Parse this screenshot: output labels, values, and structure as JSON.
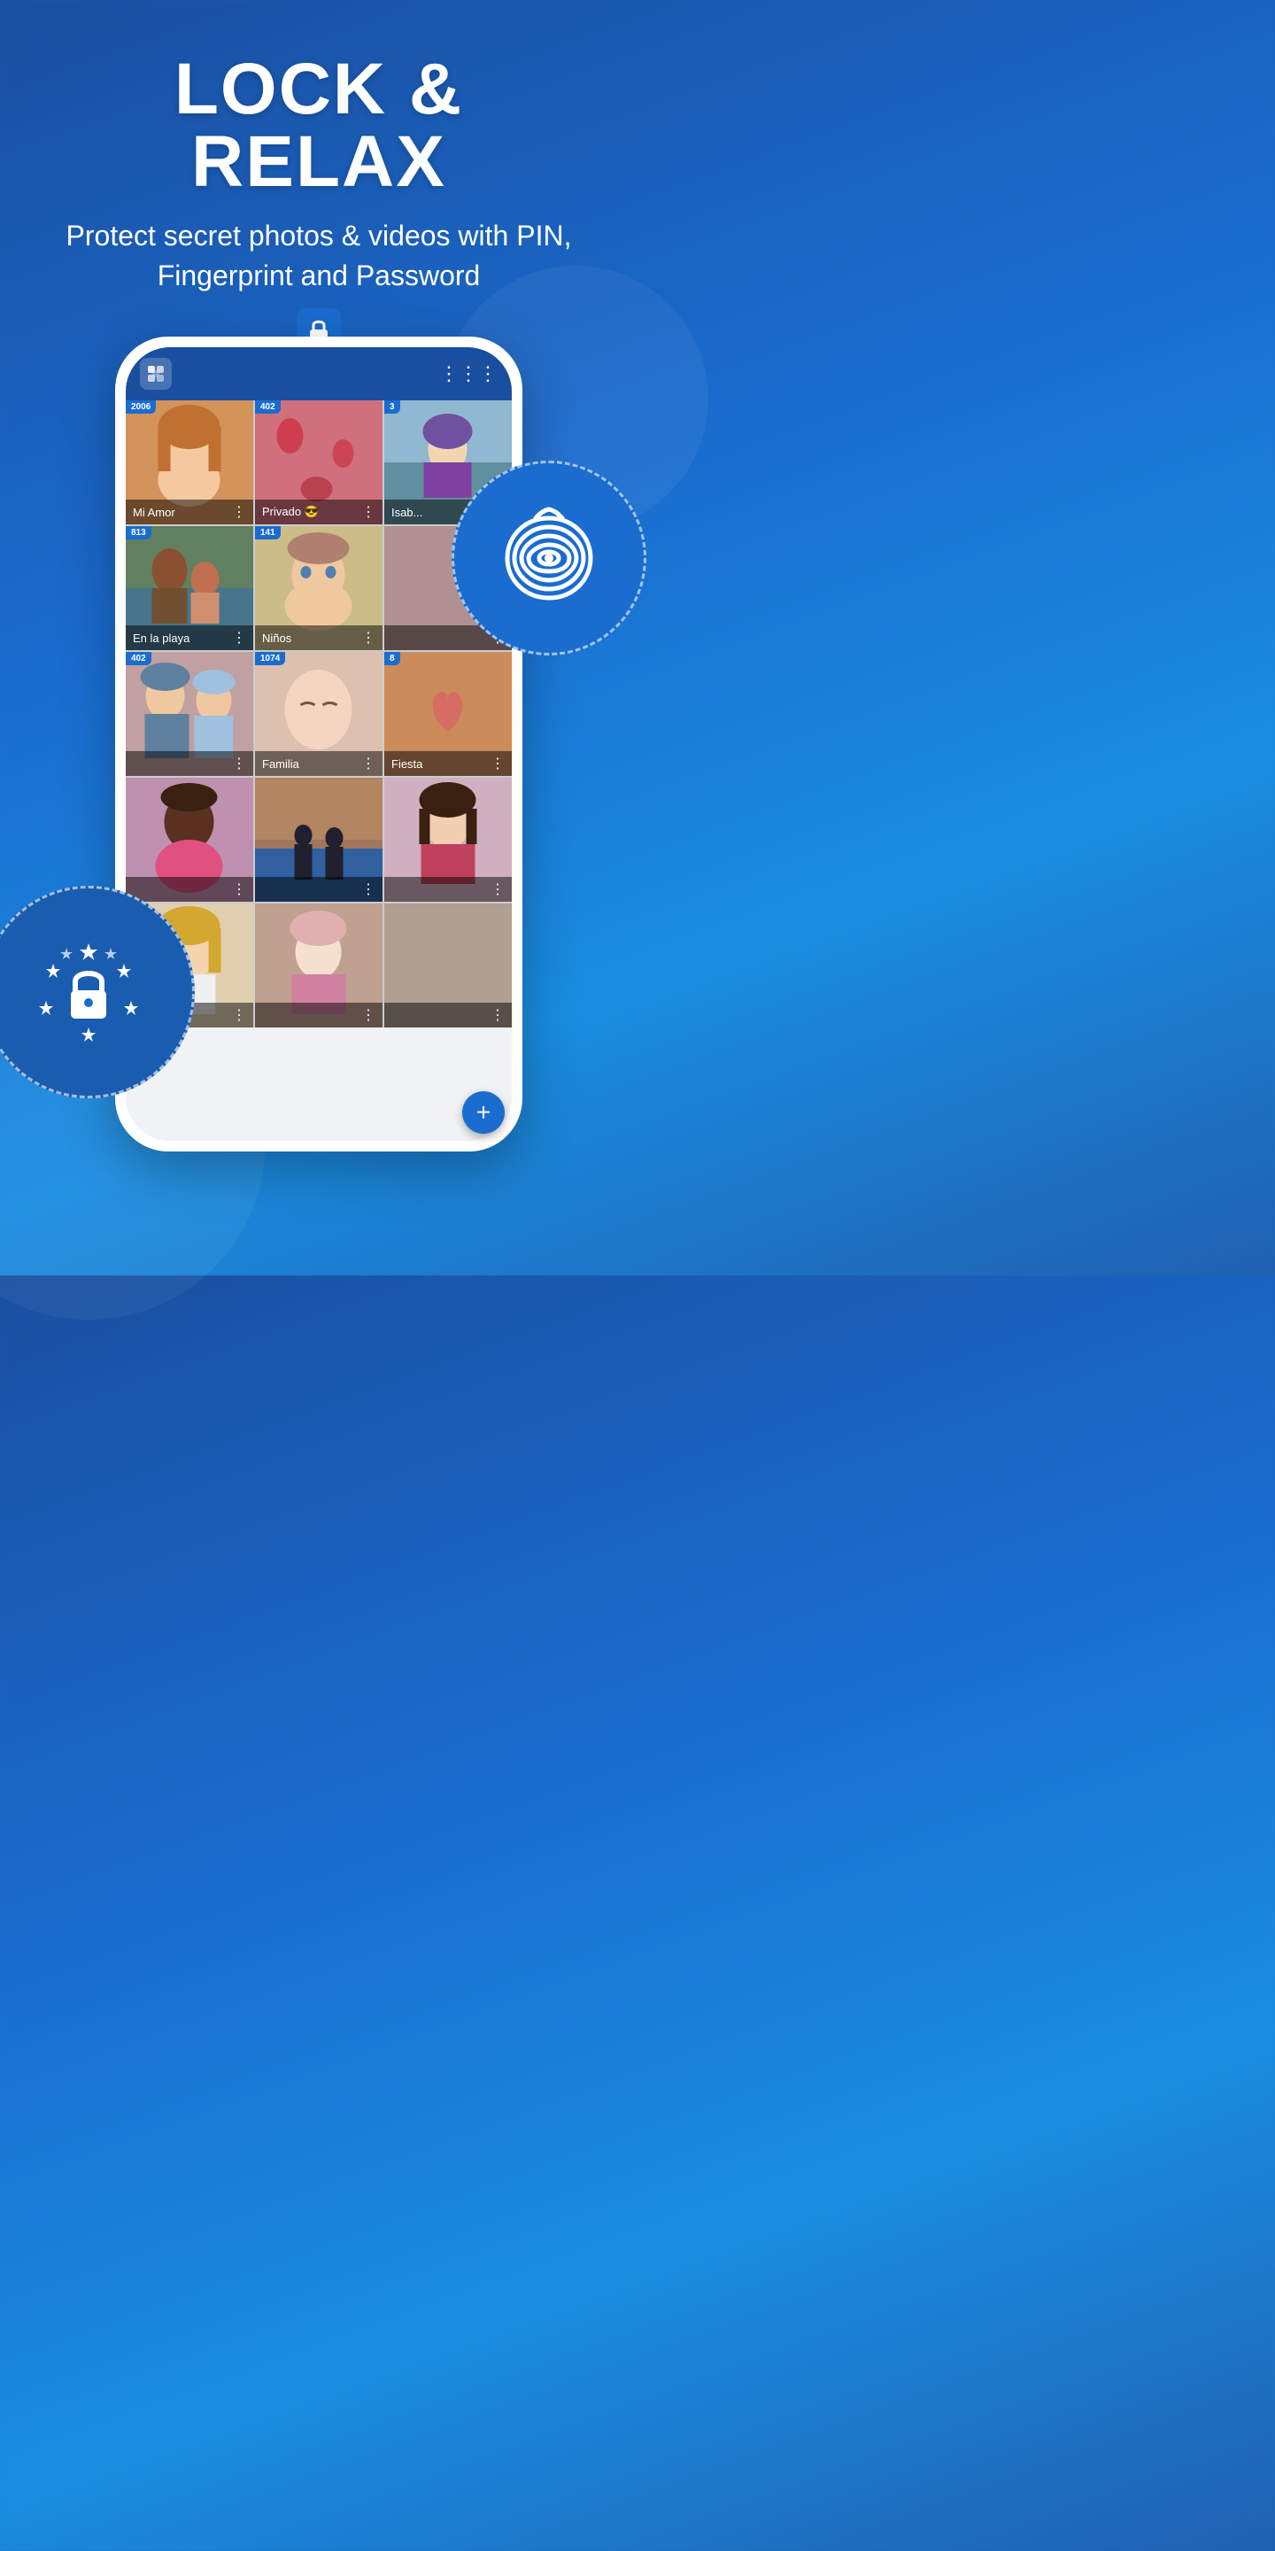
{
  "header": {
    "title": "LOCK & RELAX",
    "subtitle": "Protect secret photos & videos with PIN, Fingerprint and Password"
  },
  "app": {
    "logo_label": "secure gallery app"
  },
  "gallery": {
    "items": [
      {
        "id": 1,
        "name": "Mi Amor",
        "badge": "2006",
        "photo_class": "photo-1"
      },
      {
        "id": 2,
        "name": "Privado 😎",
        "badge": "402",
        "photo_class": "photo-2"
      },
      {
        "id": 3,
        "name": "Isab...",
        "badge": "3",
        "photo_class": "photo-3"
      },
      {
        "id": 4,
        "name": "En la playa",
        "badge": "813",
        "photo_class": "photo-4"
      },
      {
        "id": 5,
        "name": "Niños",
        "badge": "141",
        "photo_class": "photo-5"
      },
      {
        "id": 6,
        "name": "",
        "badge": "",
        "photo_class": "photo-6"
      },
      {
        "id": 7,
        "name": "",
        "badge": "402",
        "photo_class": "photo-7"
      },
      {
        "id": 8,
        "name": "Familia",
        "badge": "1074",
        "photo_class": "photo-8"
      },
      {
        "id": 9,
        "name": "Fiesta",
        "badge": "8",
        "photo_class": "photo-9"
      },
      {
        "id": 10,
        "name": "",
        "badge": "",
        "photo_class": "photo-10"
      },
      {
        "id": 11,
        "name": "",
        "badge": "",
        "photo_class": "photo-11"
      },
      {
        "id": 12,
        "name": "",
        "badge": "",
        "photo_class": "photo-12"
      },
      {
        "id": 13,
        "name": "",
        "badge": "",
        "photo_class": "photo-13"
      },
      {
        "id": 14,
        "name": "",
        "badge": "",
        "photo_class": "photo-14"
      }
    ],
    "fab_label": "+"
  }
}
